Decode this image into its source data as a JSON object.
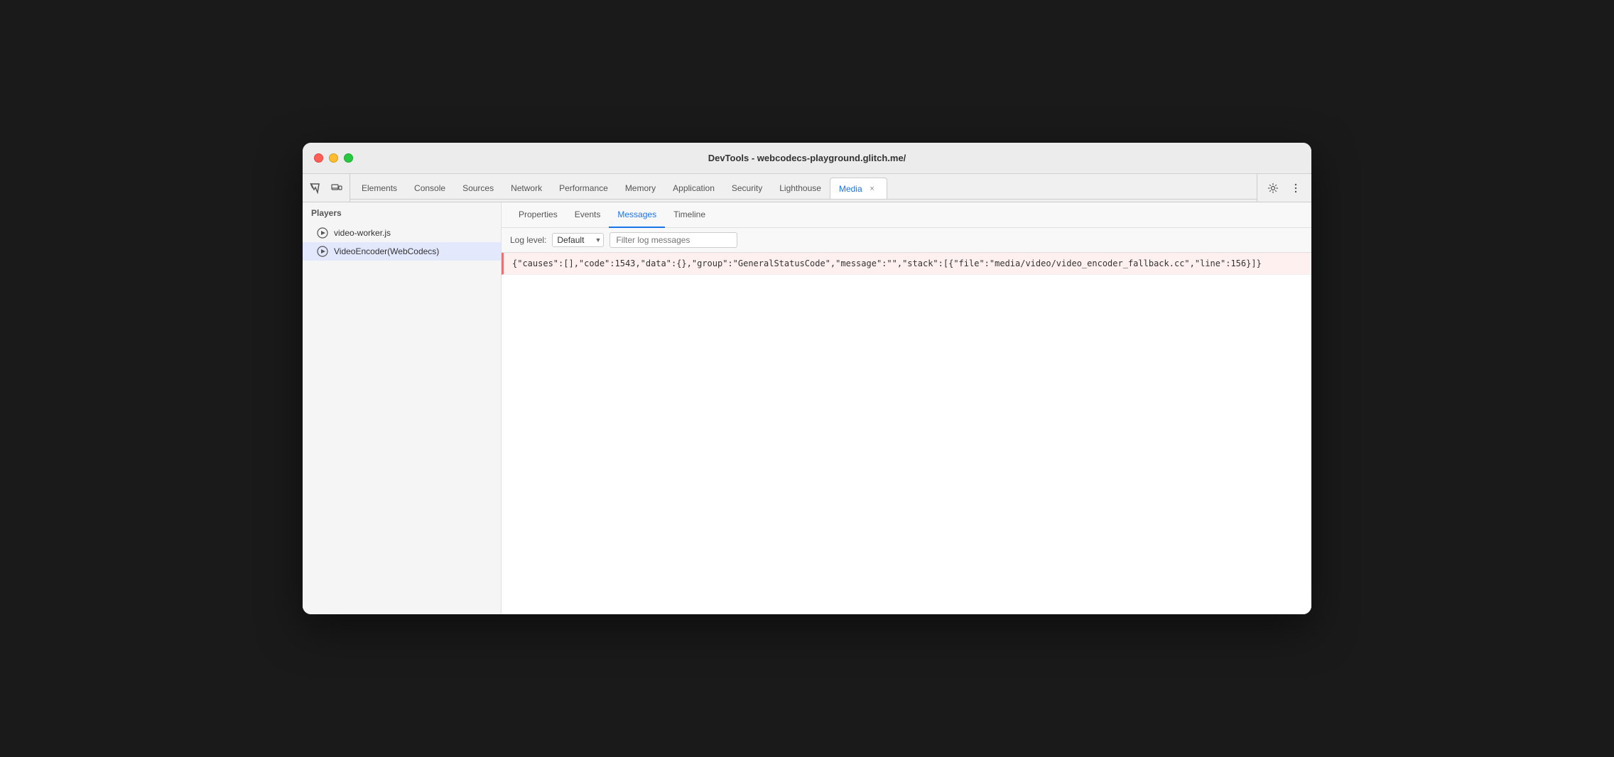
{
  "window": {
    "title": "DevTools - webcodecs-playground.glitch.me/"
  },
  "traffic_lights": {
    "red_label": "close",
    "yellow_label": "minimize",
    "green_label": "maximize"
  },
  "toolbar": {
    "inspect_label": "inspect",
    "device_label": "device",
    "separator": true,
    "settings_label": "settings",
    "more_label": "more"
  },
  "tabs": [
    {
      "id": "elements",
      "label": "Elements",
      "active": false,
      "closable": false
    },
    {
      "id": "console",
      "label": "Console",
      "active": false,
      "closable": false
    },
    {
      "id": "sources",
      "label": "Sources",
      "active": false,
      "closable": false
    },
    {
      "id": "network",
      "label": "Network",
      "active": false,
      "closable": false
    },
    {
      "id": "performance",
      "label": "Performance",
      "active": false,
      "closable": false
    },
    {
      "id": "memory",
      "label": "Memory",
      "active": false,
      "closable": false
    },
    {
      "id": "application",
      "label": "Application",
      "active": false,
      "closable": false
    },
    {
      "id": "security",
      "label": "Security",
      "active": false,
      "closable": false
    },
    {
      "id": "lighthouse",
      "label": "Lighthouse",
      "active": false,
      "closable": false
    },
    {
      "id": "media",
      "label": "Media",
      "active": true,
      "closable": true
    }
  ],
  "sidebar": {
    "header": "Players",
    "items": [
      {
        "id": "video-worker",
        "label": "video-worker.js",
        "selected": false
      },
      {
        "id": "video-encoder",
        "label": "VideoEncoder(WebCodecs)",
        "selected": true
      }
    ]
  },
  "content_tabs": [
    {
      "id": "properties",
      "label": "Properties",
      "active": false
    },
    {
      "id": "events",
      "label": "Events",
      "active": false
    },
    {
      "id": "messages",
      "label": "Messages",
      "active": true
    },
    {
      "id": "timeline",
      "label": "Timeline",
      "active": false
    }
  ],
  "log_toolbar": {
    "level_label": "Log level:",
    "level_value": "Default",
    "filter_placeholder": "Filter log messages"
  },
  "log_entries": [
    {
      "id": "entry-1",
      "type": "error",
      "text": "{\"causes\":[],\"code\":1543,\"data\":{},\"group\":\"GeneralStatusCode\",\"message\":\"\",\"stack\":[{\"file\":\"media/video/video_encoder_fallback.cc\",\"line\":156}]}"
    }
  ]
}
